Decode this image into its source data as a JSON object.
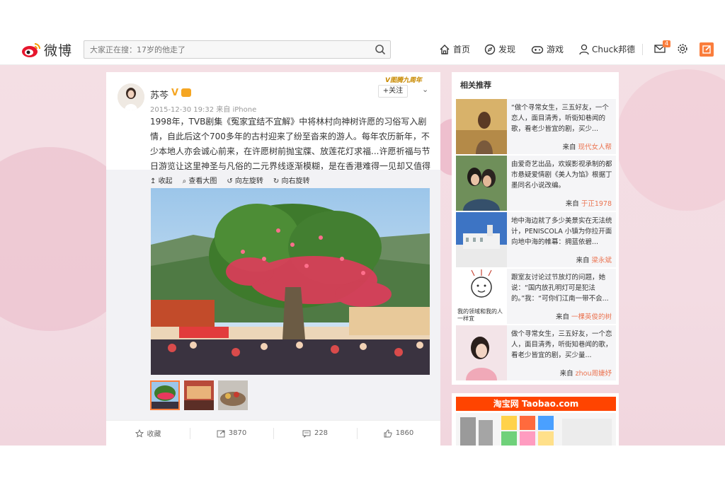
{
  "header": {
    "logo_text": "微博",
    "search_value": "大家正在搜：17岁的他走了",
    "nav": [
      {
        "label": "首页",
        "icon": "home-icon"
      },
      {
        "label": "发现",
        "icon": "compass-icon"
      },
      {
        "label": "游戏",
        "icon": "gamepad-icon"
      },
      {
        "label": "Chuck邦德",
        "icon": "user-icon"
      }
    ],
    "message_count": "4",
    "accent": "#fa7d3c"
  },
  "post": {
    "username": "苏芩",
    "verified_mark": "V",
    "meta": "2015-12-30 19:32 来自 iPhone",
    "follow_label": "+关注",
    "follow_tag": "V图腾九周年",
    "text_parts": [
      "1998年，TVB剧集《冤家宜结不宜解》中将林村向神树许愿的习俗写入剧情，自此后这个700多年的古村迎来了纷至沓来的游人。每年农历新年，不少本地人亦会诚心前来，在许愿树前抛宝牒、放莲花灯求福...许愿祈福与节日游览让这里神圣与凡俗的二元界线逐渐模糊，是在香港难得一见却又值得体验的传统新春活动。"
    ],
    "media_tools": [
      "收起",
      "查看大图",
      "向左旋转",
      "向右旋转"
    ],
    "actions": [
      {
        "label": "收藏",
        "icon": "star-icon"
      },
      {
        "label": "3870",
        "icon": "share-icon"
      },
      {
        "label": "228",
        "icon": "comment-icon"
      },
      {
        "label": "1860",
        "icon": "like-icon"
      }
    ]
  },
  "side": {
    "title": "相关推荐",
    "items": [
      {
        "text": "“做个寻常女生，三五好友，一个恋人，面目清秀，听街知巷闻的歌，看老少皆宜的剧，买少...",
        "from_label": "来自",
        "author": "现代女人帮"
      },
      {
        "text": "由爱奇艺出品，欢娱影视承制的都市悬疑爱情剧《美人为馅》根据丁墨同名小说改编。",
        "from_label": "来自",
        "author": "于正1978"
      },
      {
        "text": "地中海边就了多少美景实在无法统计，PENISCOLA 小镇为你拉开面向地中海的帷幕：拥蓝依碧...",
        "from_label": "来自",
        "author": "梁永斌"
      },
      {
        "text": "跟室友讨论过节放灯的问题，她说：“国内放孔明灯可是犯法的。”我：“可你们江南一带不会...",
        "from_label": "来自",
        "author": "一棵英俊的树"
      },
      {
        "text": "做个寻常女生，三五好友，一个恋人，面目清秀，听街知巷闻的歌，看老少皆宜的剧，买少量...",
        "from_label": "来自",
        "author": "zhou周婕妤"
      }
    ],
    "thumb_caption": "我的领域和我的人一样宜",
    "ad_title": "淘宝网 Taobao.com"
  }
}
